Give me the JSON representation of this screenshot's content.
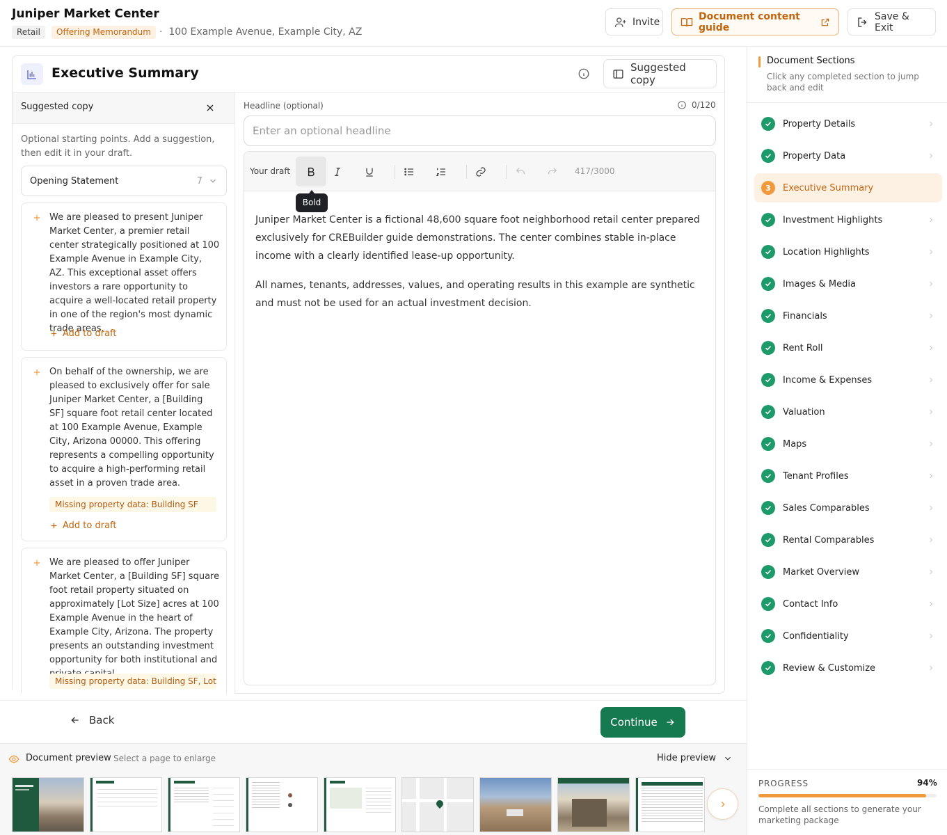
{
  "header": {
    "title": "Juniper Market Center",
    "tags": [
      "Retail",
      "Offering Memorandum"
    ],
    "address": "100 Example Avenue, Example City, AZ",
    "invite_label": "Invite",
    "guide_label": "Document content guide",
    "save_label": "Save & Exit"
  },
  "section": {
    "title": "Executive Summary",
    "suggested_copy_button": "Suggested copy"
  },
  "suggested_panel": {
    "title": "Suggested copy",
    "intro": "Optional starting points. Add a suggestion, then edit it in your draft.",
    "dropdown": {
      "label": "Opening Statement",
      "count": "7"
    },
    "add_label": "Add to draft",
    "suggestions": [
      {
        "text": "We are pleased to present Juniper Market Center, a premier retail center strategically positioned at 100 Example Avenue in Example City, AZ. This exceptional asset offers investors a rare opportunity to acquire a well-located retail property in one of the region's most dynamic trade areas.",
        "missing": ""
      },
      {
        "text": "On behalf of the ownership, we are pleased to exclusively offer for sale Juniper Market Center, a [Building SF] square foot retail center located at 100 Example Avenue, Example City, Arizona 00000. This offering represents a compelling opportunity to acquire a high-performing retail asset in a proven trade area.",
        "missing": "Missing property data: Building SF"
      },
      {
        "text": "We are pleased to offer Juniper Market Center, a [Building SF] square foot retail property situated on approximately [Lot Size] acres at 100 Example Avenue in the heart of Example City, Arizona. The property presents an outstanding investment opportunity for both institutional and private capital.",
        "missing": "Missing property data: Building SF, Lot"
      }
    ]
  },
  "editor": {
    "headline_label": "Headline (optional)",
    "headline_count": "0/120",
    "headline_placeholder": "Enter an optional headline",
    "draft_label": "Your draft",
    "char_count": "417/3000",
    "tooltip": "Bold",
    "paragraphs": [
      "Juniper Market Center is a fictional 48,600 square foot neighborhood retail center prepared exclusively for CREBuilder guide demonstrations. The center combines stable in-place income with a clearly identified lease-up opportunity.",
      "All names, tenants, addresses, values, and operating results in this example are synthetic and must not be used for an actual investment decision."
    ]
  },
  "nav": {
    "back_label": "Back",
    "continue_label": "Continue"
  },
  "preview": {
    "title": "Document preview",
    "subtitle": "Select a page to enlarge",
    "hide_label": "Hide preview"
  },
  "sidebar": {
    "title": "Document Sections",
    "subtitle": "Click any completed section to jump back and edit",
    "items": [
      {
        "label": "Property Details",
        "status": "complete"
      },
      {
        "label": "Property Data",
        "status": "complete"
      },
      {
        "label": "Executive Summary",
        "status": "current",
        "step": "3"
      },
      {
        "label": "Investment Highlights",
        "status": "complete"
      },
      {
        "label": "Location Highlights",
        "status": "complete"
      },
      {
        "label": "Images & Media",
        "status": "complete"
      },
      {
        "label": "Financials",
        "status": "complete"
      },
      {
        "label": "Rent Roll",
        "status": "complete"
      },
      {
        "label": "Income & Expenses",
        "status": "complete"
      },
      {
        "label": "Valuation",
        "status": "complete"
      },
      {
        "label": "Maps",
        "status": "complete"
      },
      {
        "label": "Tenant Profiles",
        "status": "complete"
      },
      {
        "label": "Sales Comparables",
        "status": "complete"
      },
      {
        "label": "Rental Comparables",
        "status": "complete"
      },
      {
        "label": "Market Overview",
        "status": "complete"
      },
      {
        "label": "Contact Info",
        "status": "complete"
      },
      {
        "label": "Confidentiality",
        "status": "complete"
      },
      {
        "label": "Review & Customize",
        "status": "complete"
      }
    ],
    "progress": {
      "label": "PROGRESS",
      "percent_text": "94%",
      "value": 0.94,
      "description": "Complete all sections to generate your marketing package"
    }
  },
  "colors": {
    "accent": "#f09a3c",
    "accent_text": "#c2650e",
    "success": "#1d9a6a",
    "primary_button": "#157a4f"
  }
}
